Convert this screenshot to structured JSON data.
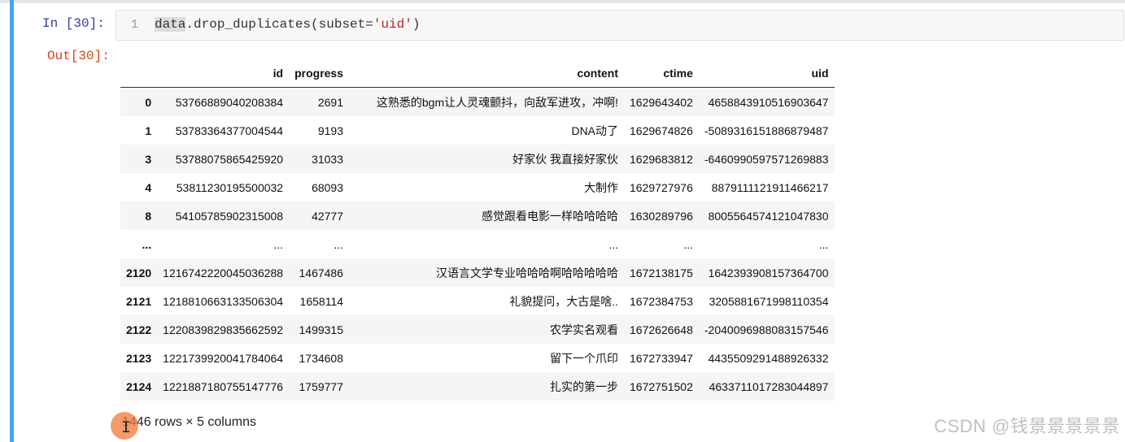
{
  "input": {
    "prompt": "In  [30]:",
    "line_number": "1",
    "code_var": "data",
    "code_method": ".drop_duplicates(subset=",
    "code_string": "'uid'",
    "code_close": ")"
  },
  "output": {
    "prompt": "Out[30]:",
    "table": {
      "columns": [
        "",
        "id",
        "progress",
        "content",
        "ctime",
        "uid"
      ],
      "rows": [
        [
          "0",
          "53766889040208384",
          "2691",
          "这熟悉的bgm让人灵魂颤抖，向敌军进攻，冲啊!",
          "1629643402",
          "4658843910516903647"
        ],
        [
          "1",
          "53783364377004544",
          "9193",
          "DNA动了",
          "1629674826",
          "-5089316151886879487"
        ],
        [
          "3",
          "53788075865425920",
          "31033",
          "好家伙 我直接好家伙",
          "1629683812",
          "-6460990597571269883"
        ],
        [
          "4",
          "53811230195500032",
          "68093",
          "大制作",
          "1629727976",
          "8879111121911466217"
        ],
        [
          "8",
          "54105785902315008",
          "42777",
          "感觉跟看电影一样哈哈哈哈",
          "1630289796",
          "8005564574121047830"
        ],
        [
          "...",
          "...",
          "...",
          "...",
          "...",
          "..."
        ],
        [
          "2120",
          "1216742220045036288",
          "1467486",
          "汉语言文学专业哈哈哈啊哈哈哈哈哈",
          "1672138175",
          "1642393908157364700"
        ],
        [
          "2121",
          "1218810663133506304",
          "1658114",
          "礼貌提问，大古是啥..",
          "1672384753",
          "3205881671998110354"
        ],
        [
          "2122",
          "1220839829835662592",
          "1499315",
          "农学实名观看",
          "1672626648",
          "-2040096988083157546"
        ],
        [
          "2123",
          "1221739920041784064",
          "1734608",
          "留下一个爪印",
          "1672733947",
          "4435509291488926332"
        ],
        [
          "2124",
          "1221887180755147776",
          "1759777",
          "扎实的第一步",
          "1672751502",
          "4633711017283044897"
        ]
      ]
    },
    "summary": "1446 rows × 5 columns"
  },
  "watermark": "CSDN @钱景景景景景",
  "colors": {
    "cell_accent": "#42a5f5",
    "in_prompt": "#303f9f",
    "out_prompt": "#d84315",
    "cursor_highlight": "#f0783c"
  },
  "icons": {
    "cursor": "text-cursor-icon"
  }
}
